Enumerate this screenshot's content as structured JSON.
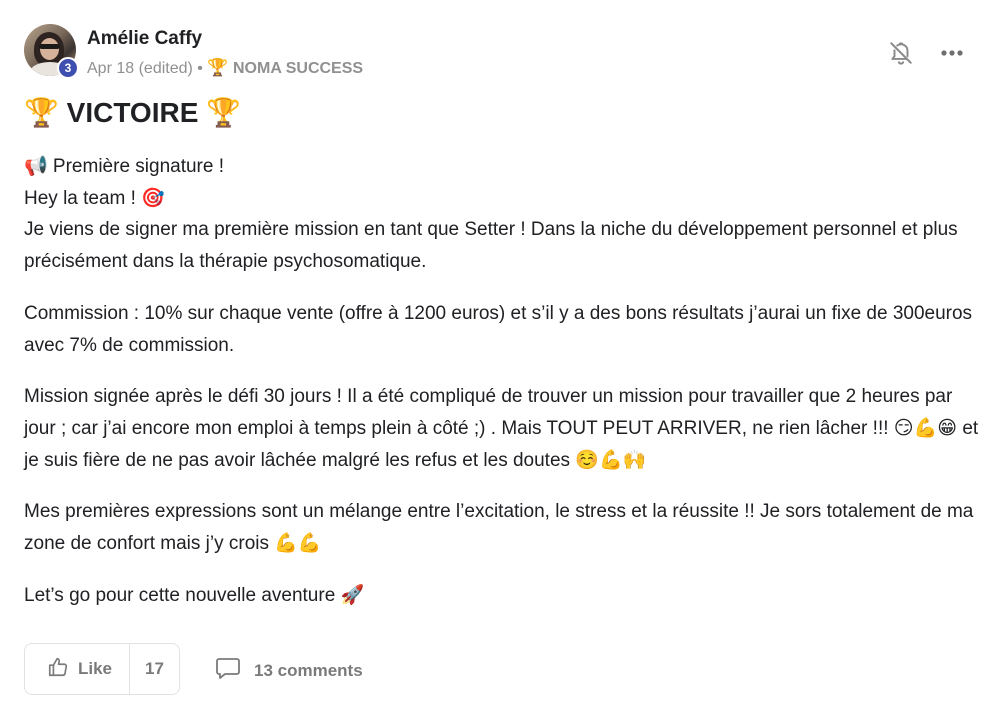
{
  "post": {
    "author": "Amélie Caffy",
    "level": "3",
    "date": "Apr 18 (edited)",
    "separator": "•",
    "category_emoji": "🏆",
    "category": "NOMA SUCCESS",
    "title": "🏆 VICTOIRE 🏆",
    "paragraphs": [
      {
        "lines": [
          "📢 Première signature !",
          "Hey la team ! 🎯",
          "Je viens de signer ma première mission en tant que Setter ! Dans la niche du développement personnel et plus précisément dans la thérapie psychosomatique."
        ]
      },
      {
        "text": "Commission : 10% sur chaque vente (offre à 1200 euros) et s’il y a des bons résultats j’aurai un fixe de 300euros avec 7% de commission."
      },
      {
        "text": "Mission signée après le défi 30 jours ! Il a été compliqué de trouver un mission pour travailler que 2 heures par jour ; car j’ai encore mon emploi à temps plein à côté ;) . Mais TOUT PEUT ARRIVER, ne rien lâcher !!! 😏💪😁 et je suis fière de ne pas avoir lâchée malgré les refus et les doutes ☺️💪🙌"
      },
      {
        "text": "Mes premières expressions sont un mélange entre l’excitation, le stress et la réussite !! Je sors totalement de ma zone de confort mais j’y crois 💪💪"
      },
      {
        "text": "Let’s go pour cette nouvelle aventure 🚀"
      }
    ]
  },
  "footer": {
    "like_label": "Like",
    "like_count": "17",
    "comments_label": "13 comments"
  },
  "icons": {
    "bell": "bell-off-icon",
    "more": "more-horizontal-icon",
    "like": "thumbs-up-icon",
    "comment": "comment-bubble-icon"
  },
  "colors": {
    "level_badge": "#3f4fb0",
    "muted_text": "#909090",
    "footer_text": "#7a7a7a"
  }
}
